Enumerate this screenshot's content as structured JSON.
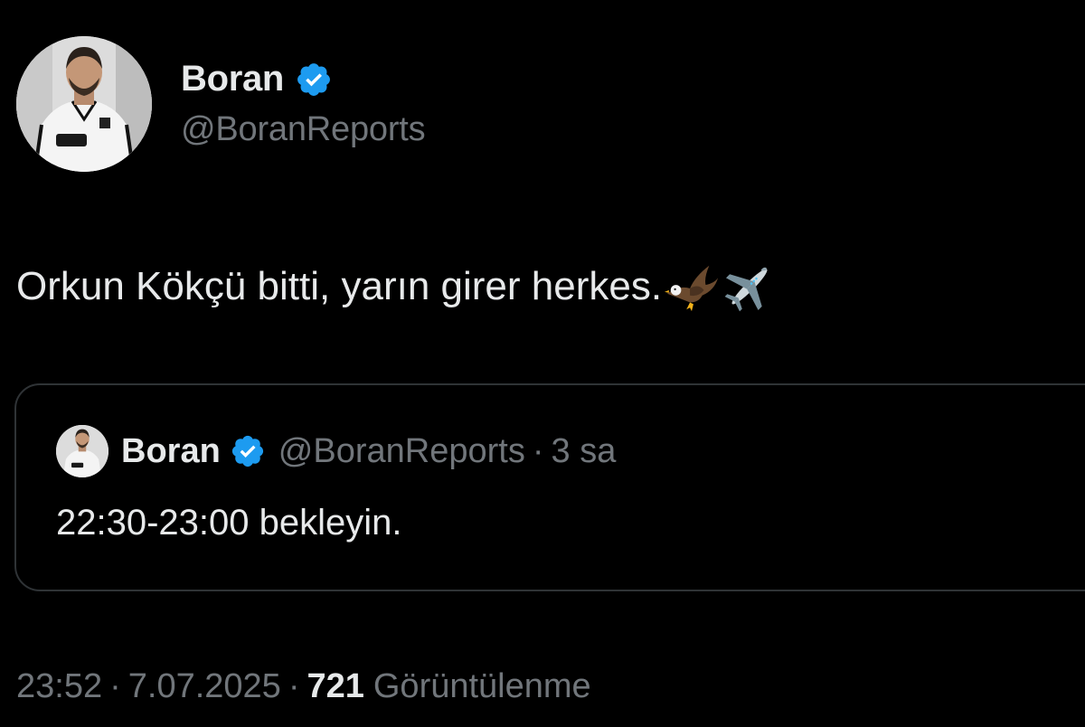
{
  "author": {
    "display_name": "Boran",
    "handle": "@BoranReports",
    "verified": true,
    "avatar_icon": "profile-photo-player-in-white-kit",
    "verified_color": "#1d9bf0"
  },
  "tweet": {
    "text": "Orkun Kökçü bitti, yarın girer herkes.",
    "emojis": [
      "eagle-emoji",
      "airplane-emoji"
    ]
  },
  "quoted_tweet": {
    "display_name": "Boran",
    "handle": "@BoranReports",
    "separator": "·",
    "time_ago": "3 sa",
    "text": "22:30-23:00 bekleyin."
  },
  "meta": {
    "time": "23:52",
    "separator": "·",
    "date": "7.07.2025",
    "views_count": "721",
    "views_label": "Görüntülenme"
  },
  "colors": {
    "background": "#000000",
    "primary_text": "#e7e9ea",
    "secondary_text": "#71767b",
    "border": "#2f3336",
    "verified_blue": "#1d9bf0"
  }
}
